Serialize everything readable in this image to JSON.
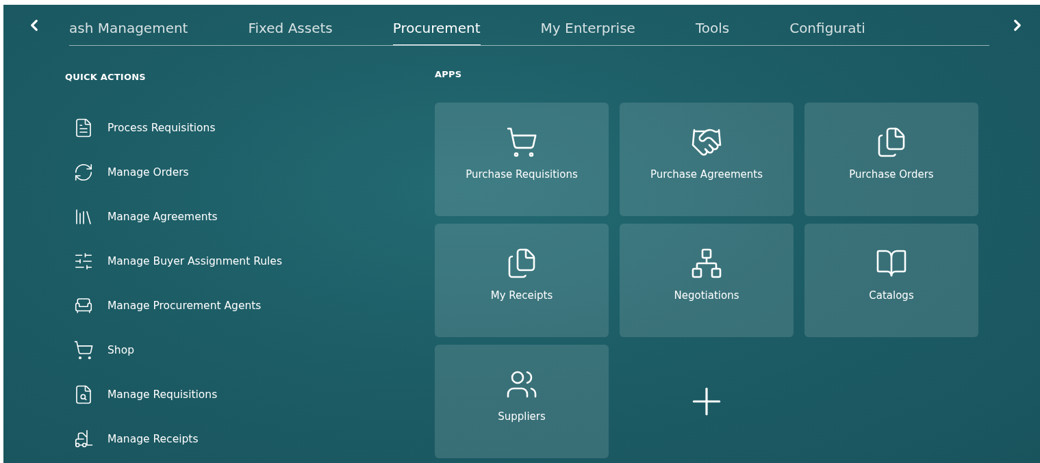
{
  "nav": {
    "tabs": [
      {
        "label": "ash Management",
        "selected": false
      },
      {
        "label": "Fixed Assets",
        "selected": false
      },
      {
        "label": "Procurement",
        "selected": true
      },
      {
        "label": "My Enterprise",
        "selected": false
      },
      {
        "label": "Tools",
        "selected": false
      },
      {
        "label": "Configurati",
        "selected": false
      }
    ]
  },
  "quick_actions": {
    "heading": "QUICK ACTIONS",
    "items": [
      {
        "label": "Process Requisitions"
      },
      {
        "label": "Manage Orders"
      },
      {
        "label": "Manage Agreements"
      },
      {
        "label": "Manage Buyer Assignment Rules"
      },
      {
        "label": "Manage Procurement Agents"
      },
      {
        "label": "Shop"
      },
      {
        "label": "Manage Requisitions"
      },
      {
        "label": "Manage Receipts"
      }
    ]
  },
  "apps": {
    "heading": "APPS",
    "tiles": [
      {
        "kind": "app",
        "label": "Purchase Requisitions"
      },
      {
        "kind": "app",
        "label": "Purchase Agreements"
      },
      {
        "kind": "app",
        "label": "Purchase Orders"
      },
      {
        "kind": "app",
        "label": "My Receipts"
      },
      {
        "kind": "app",
        "label": "Negotiations"
      },
      {
        "kind": "app",
        "label": "Catalogs"
      },
      {
        "kind": "app",
        "label": "Suppliers"
      },
      {
        "kind": "add"
      }
    ]
  }
}
